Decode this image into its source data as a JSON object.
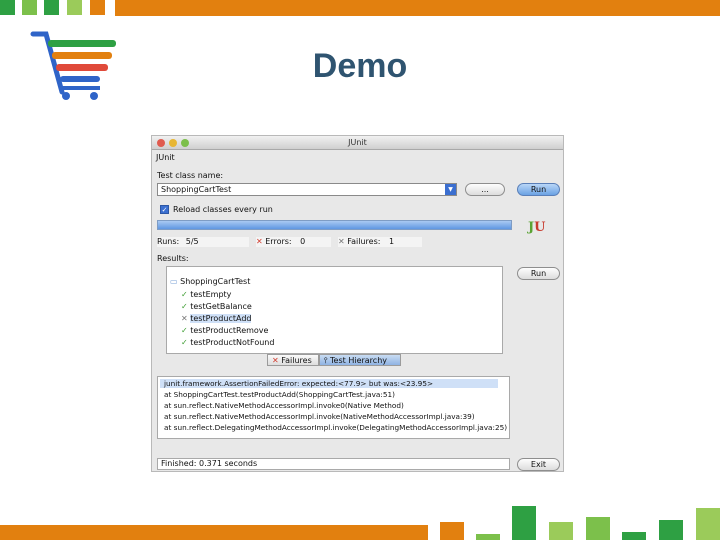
{
  "slide": {
    "title": "Demo",
    "colors": {
      "orange": "#e2800f",
      "green_dark": "#2ea043",
      "green_mid": "#7cc04b",
      "green_light": "#9bcb5a",
      "title_color": "#2f5470"
    },
    "cart_icon": "shopping-cart-icon"
  },
  "junit": {
    "window_title": "JUnit",
    "menu_label": "JUnit",
    "test_class_label": "Test class name:",
    "test_class_value": "ShoppingCartTest",
    "browse_button": "...",
    "run_button": "Run",
    "reload_label": "Reload classes every run",
    "runs_label": "Runs:",
    "runs_value": "5/5",
    "errors_label": "Errors:",
    "errors_value": "0",
    "failures_label": "Failures:",
    "failures_value": "1",
    "results_label": "Results:",
    "results_run_button": "Run",
    "tree": {
      "root": "ShoppingCartTest",
      "tests": [
        {
          "name": "testEmpty",
          "status": "pass"
        },
        {
          "name": "testGetBalance",
          "status": "pass"
        },
        {
          "name": "testProductAdd",
          "status": "fail"
        },
        {
          "name": "testProductRemove",
          "status": "pass"
        },
        {
          "name": "testProductNotFound",
          "status": "pass"
        }
      ]
    },
    "tabs": {
      "failures": "Failures",
      "hierarchy": "Test Hierarchy"
    },
    "trace": [
      "junit.framework.AssertionFailedError: expected:<77.9> but was:<23.95>",
      "at ShoppingCartTest.testProductAdd(ShoppingCartTest.java:51)",
      "at sun.reflect.NativeMethodAccessorImpl.invoke0(Native Method)",
      "at sun.reflect.NativeMethodAccessorImpl.invoke(NativeMethodAccessorImpl.java:39)",
      "at sun.reflect.DelegatingMethodAccessorImpl.invoke(DelegatingMethodAccessorImpl.java:25)"
    ],
    "finished_text": "Finished: 0.371 seconds",
    "exit_button": "Exit"
  }
}
